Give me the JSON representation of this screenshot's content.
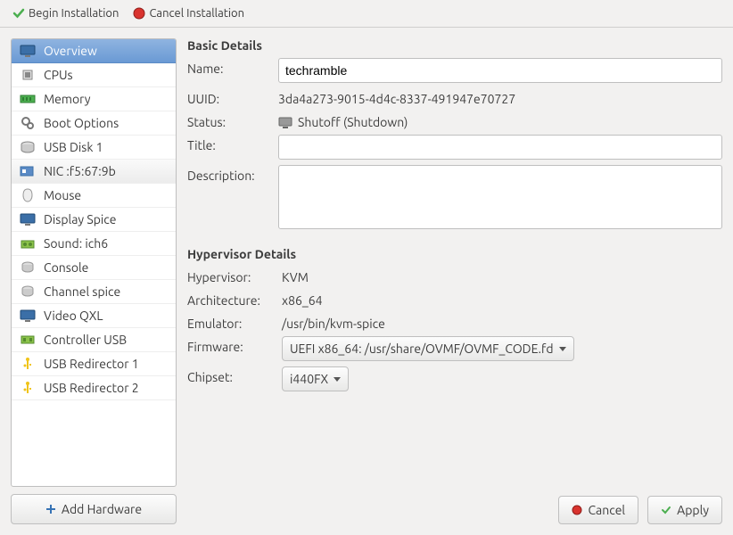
{
  "toolbar": {
    "begin_label": "Begin Installation",
    "cancel_label": "Cancel Installation"
  },
  "sidebar": {
    "items": [
      {
        "label": "Overview",
        "icon": "monitor"
      },
      {
        "label": "CPUs",
        "icon": "cpu"
      },
      {
        "label": "Memory",
        "icon": "memory"
      },
      {
        "label": "Boot Options",
        "icon": "gears"
      },
      {
        "label": "USB Disk 1",
        "icon": "disk"
      },
      {
        "label": "NIC :f5:67:9b",
        "icon": "nic"
      },
      {
        "label": "Mouse",
        "icon": "mouse"
      },
      {
        "label": "Display Spice",
        "icon": "monitor"
      },
      {
        "label": "Sound: ich6",
        "icon": "sound"
      },
      {
        "label": "Console",
        "icon": "console"
      },
      {
        "label": "Channel spice",
        "icon": "console"
      },
      {
        "label": "Video QXL",
        "icon": "monitor"
      },
      {
        "label": "Controller USB",
        "icon": "controller"
      },
      {
        "label": "USB Redirector 1",
        "icon": "usb"
      },
      {
        "label": "USB Redirector 2",
        "icon": "usb"
      }
    ],
    "add_hardware_label": "Add Hardware"
  },
  "basic": {
    "heading": "Basic Details",
    "name_label": "Name:",
    "name_value": "techramble",
    "uuid_label": "UUID:",
    "uuid_value": "3da4a273-9015-4d4c-8337-491947e70727",
    "status_label": "Status:",
    "status_value": "Shutoff (Shutdown)",
    "title_label": "Title:",
    "title_value": "",
    "description_label": "Description:",
    "description_value": ""
  },
  "hypervisor": {
    "heading": "Hypervisor Details",
    "hypervisor_label": "Hypervisor:",
    "hypervisor_value": "KVM",
    "arch_label": "Architecture:",
    "arch_value": "x86_64",
    "emulator_label": "Emulator:",
    "emulator_value": "/usr/bin/kvm-spice",
    "firmware_label": "Firmware:",
    "firmware_value": "UEFI x86_64: /usr/share/OVMF/OVMF_CODE.fd",
    "chipset_label": "Chipset:",
    "chipset_value": "i440FX"
  },
  "footer": {
    "cancel_label": "Cancel",
    "apply_label": "Apply"
  }
}
